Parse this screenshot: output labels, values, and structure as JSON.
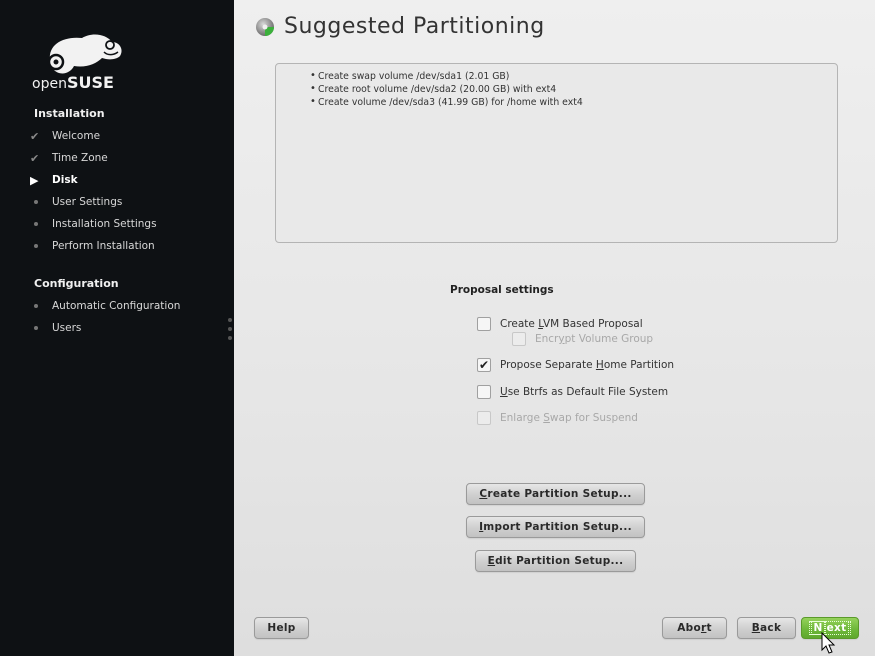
{
  "sidebar": {
    "logo_text_light": "open",
    "logo_text_bold": "SUSE",
    "sections": [
      {
        "title": "Installation",
        "items": [
          {
            "label": "Welcome",
            "state": "done",
            "icon": "checkmark-icon"
          },
          {
            "label": "Time Zone",
            "state": "done",
            "icon": "checkmark-icon"
          },
          {
            "label": "Disk",
            "state": "current",
            "icon": "current-arrow-icon"
          },
          {
            "label": "User Settings",
            "state": "pending",
            "icon": "bullet-icon"
          },
          {
            "label": "Installation Settings",
            "state": "pending",
            "icon": "bullet-icon"
          },
          {
            "label": "Perform Installation",
            "state": "pending",
            "icon": "bullet-icon"
          }
        ]
      },
      {
        "title": "Configuration",
        "items": [
          {
            "label": "Automatic Configuration",
            "state": "pending",
            "icon": "bullet-icon"
          },
          {
            "label": "Users",
            "state": "pending",
            "icon": "bullet-icon"
          }
        ]
      }
    ]
  },
  "main": {
    "title": "Suggested Partitioning",
    "summary": [
      "Create swap volume /dev/sda1 (2.01 GB)",
      "Create root volume /dev/sda2 (20.00 GB) with ext4",
      "Create volume /dev/sda3 (41.99 GB) for /home with ext4"
    ],
    "proposal_title": "Proposal settings",
    "options": {
      "lvm": {
        "pre": "Create ",
        "key": "L",
        "post": "VM Based Proposal",
        "checked": false,
        "enabled": true
      },
      "encrypt": {
        "pre": "Encr",
        "key": "y",
        "post": "pt Volume Group",
        "checked": false,
        "enabled": false
      },
      "home": {
        "pre": "Propose Separate ",
        "key": "H",
        "post": "ome Partition",
        "checked": true,
        "enabled": true
      },
      "btrfs": {
        "pre": "",
        "key": "U",
        "post": "se Btrfs as Default File System",
        "checked": false,
        "enabled": true
      },
      "swap": {
        "pre": "Enlarge ",
        "key": "S",
        "post": "wap for Suspend",
        "checked": false,
        "enabled": false
      }
    },
    "buttons": {
      "create": {
        "key": "C",
        "rest": "reate Partition Setup..."
      },
      "import": {
        "key": "I",
        "rest": "mport Partition Setup..."
      },
      "edit": {
        "key": "E",
        "rest": "dit Partition Setup..."
      }
    },
    "check_mark": "✔"
  },
  "footer": {
    "help": "Help",
    "abort_pre": "Abo",
    "abort_key": "r",
    "abort_post": "t",
    "back_key": "B",
    "back_post": "ack",
    "next_key": "N",
    "next_post": "ext"
  },
  "colors": {
    "sidebar_bg": "#0e1114",
    "accent_green": "#6fb83a"
  }
}
